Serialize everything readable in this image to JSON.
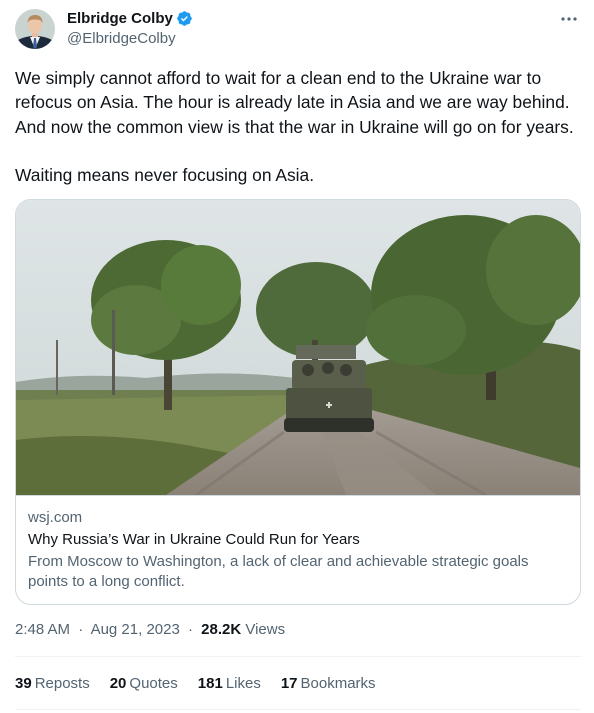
{
  "author": {
    "display_name": "Elbridge Colby",
    "handle": "@ElbridgeColby",
    "avatar_icon": "portrait-avatar",
    "verified_icon": "verified-badge-icon",
    "verified_color": "#1d9bf0"
  },
  "more_icon": "more-options-icon",
  "tweet": {
    "paragraph1": "We simply cannot afford to wait for a clean end to the Ukraine war to refocus on Asia. The hour is already late in Asia and we are way behind. And now the common view is that the war in Ukraine will go on for years.",
    "paragraph2": "Waiting means never focusing on Asia."
  },
  "card": {
    "media_icon": "military-vehicle-on-dirt-road-photo",
    "domain": "wsj.com",
    "title": "Why Russia’s War in Ukraine Could Run for Years",
    "description": "From Moscow to Washington, a lack of clear and achievable strategic goals points to a long conflict."
  },
  "meta": {
    "time": "2:48 AM",
    "separator": "·",
    "date": "Aug 21, 2023",
    "views_count": "28.2K",
    "views_label": "Views"
  },
  "stats": {
    "reposts_count": "39",
    "reposts_label": "Reposts",
    "quotes_count": "20",
    "quotes_label": "Quotes",
    "likes_count": "181",
    "likes_label": "Likes",
    "bookmarks_count": "17",
    "bookmarks_label": "Bookmarks"
  }
}
